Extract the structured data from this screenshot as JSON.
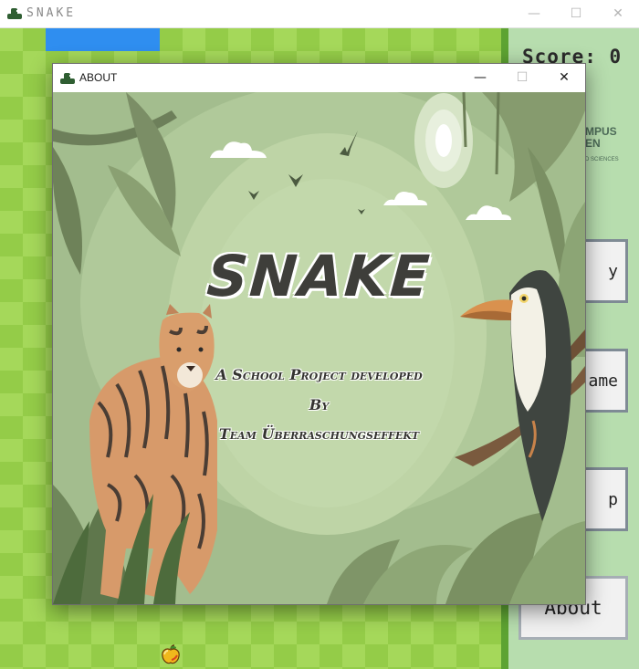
{
  "main_window": {
    "title": "SNAKE",
    "controls": {
      "minimize": "—",
      "maximize": "☐",
      "close": "✕"
    }
  },
  "side_panel": {
    "score_label": "Score: 0",
    "logo_lines": [
      "MPUS",
      "EN"
    ],
    "logo_subtitle": "D SCIENCES",
    "buttons": [
      "y",
      "ame",
      "p",
      "About"
    ]
  },
  "about_window": {
    "title": "ABOUT",
    "controls": {
      "minimize": "—",
      "maximize": "☐",
      "close": "✕"
    },
    "poster": {
      "headline": "SNAKE",
      "lines": [
        "A School Project developed",
        "By",
        "Team Überraschungseffekt"
      ]
    }
  },
  "colors": {
    "game_light": "#a5d85a",
    "game_dark": "#94cc48",
    "snake_blue": "#2f8ef0",
    "side_panel": "#b7ddae",
    "poster_bg": "#9fb98a"
  },
  "icons": {
    "app": "snake-logo-icon",
    "food": "apple-icon"
  }
}
